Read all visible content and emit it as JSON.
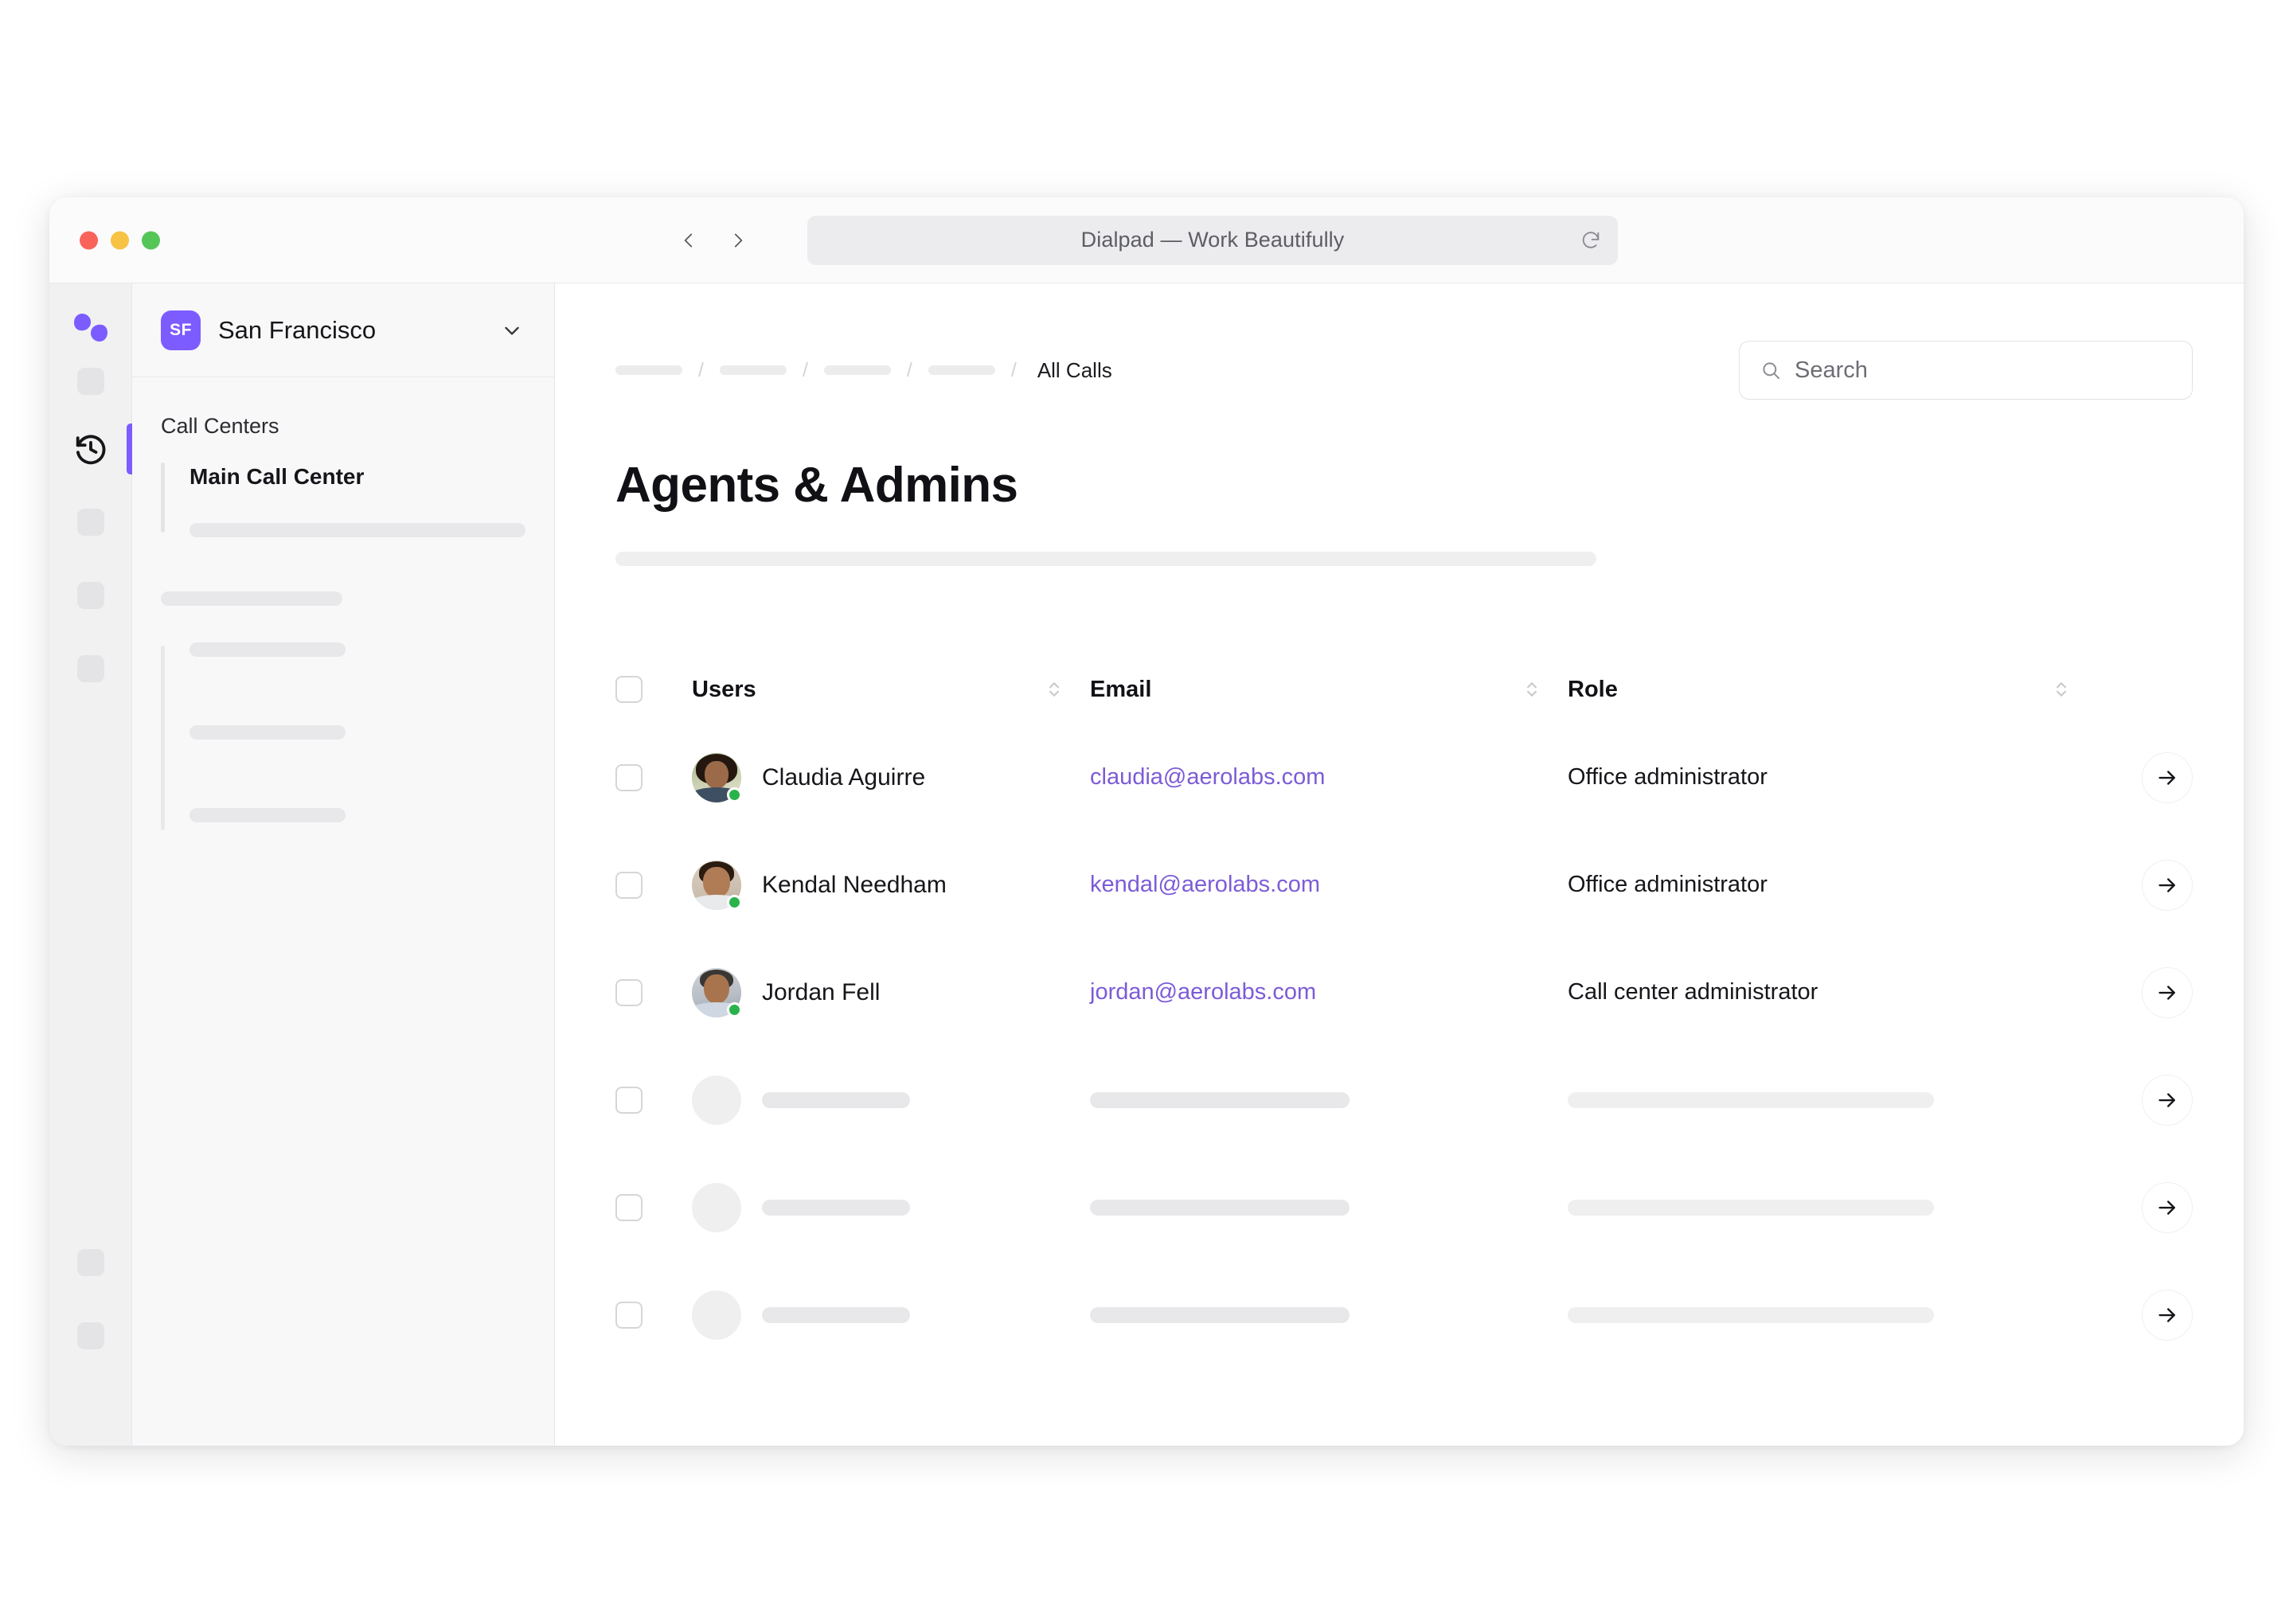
{
  "window": {
    "title": "Dialpad — Work Beautifully",
    "traffic_lights": [
      "close",
      "minimize",
      "zoom"
    ],
    "nav": {
      "back": "back-icon",
      "forward": "forward-icon",
      "reload": "reload-icon"
    }
  },
  "rail": {
    "logo": "dialpad-logo",
    "active_icon": "history-icon",
    "placeholder_count_top": 1,
    "placeholder_count_middle": 3,
    "placeholder_count_bottom": 2,
    "avatar": "user-avatar"
  },
  "sidebar": {
    "workspace": {
      "badge": "SF",
      "name": "San Francisco",
      "caret": "chevron-down-icon"
    },
    "section_title": "Call Centers",
    "active_item": "Main Call Center"
  },
  "main": {
    "breadcrumb": {
      "placeholders": 4,
      "separator": "/",
      "current": "All Calls"
    },
    "search": {
      "placeholder": "Search",
      "icon": "search-icon"
    },
    "page_title": "Agents & Admins",
    "table": {
      "columns": [
        {
          "label": "Users",
          "sortable": true
        },
        {
          "label": "Email",
          "sortable": true
        },
        {
          "label": "Role",
          "sortable": true
        }
      ],
      "rows": [
        {
          "name": "Claudia Aguirre",
          "email": "claudia@aerolabs.com",
          "role": "Office administrator",
          "status": "online",
          "avatar": "pic-claudia"
        },
        {
          "name": "Kendal Needham",
          "email": "kendal@aerolabs.com",
          "role": "Office administrator",
          "status": "online",
          "avatar": "pic-kendal"
        },
        {
          "name": "Jordan Fell",
          "email": "jordan@aerolabs.com",
          "role": "Call center administrator",
          "status": "online",
          "avatar": "pic-jordan"
        }
      ],
      "skeleton_rows": 3,
      "row_action_icon": "arrow-right-icon"
    }
  },
  "colors": {
    "accent": "#7c5cff",
    "link": "#7c5cd6",
    "status_online": "#2ab34a",
    "traffic_red": "#f9645a",
    "traffic_yellow": "#f6c344",
    "traffic_green": "#54c658"
  }
}
